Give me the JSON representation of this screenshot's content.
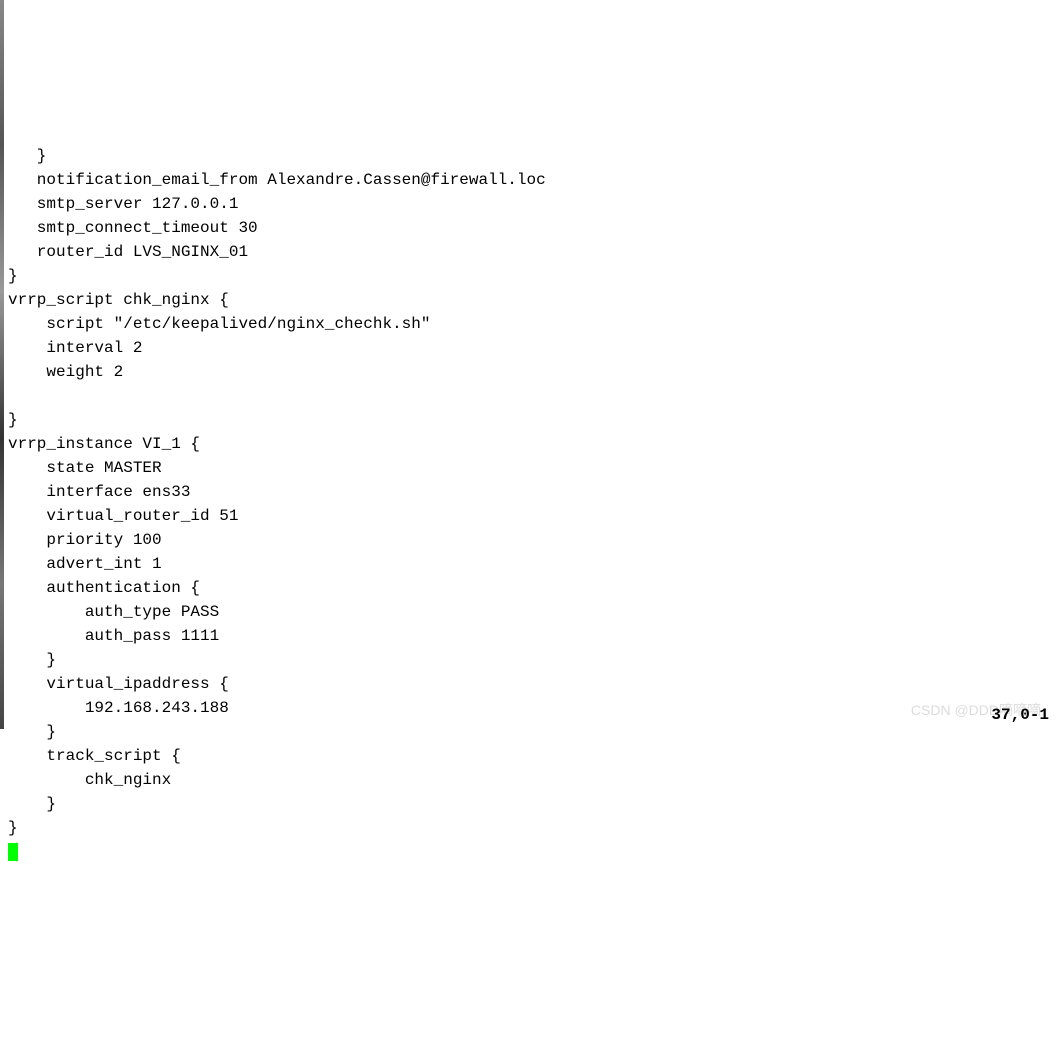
{
  "config_lines": [
    "   }",
    "   notification_email_from Alexandre.Cassen@firewall.loc",
    "   smtp_server 127.0.0.1",
    "   smtp_connect_timeout 30",
    "   router_id LVS_NGINX_01",
    "}",
    "vrrp_script chk_nginx {",
    "    script \"/etc/keepalived/nginx_chechk.sh\"",
    "    interval 2",
    "    weight 2",
    "",
    "}",
    "vrrp_instance VI_1 {",
    "    state MASTER",
    "    interface ens33",
    "    virtual_router_id 51",
    "    priority 100",
    "    advert_int 1",
    "    authentication {",
    "        auth_type PASS",
    "        auth_pass 1111",
    "    }",
    "    virtual_ipaddress {",
    "        192.168.243.188",
    "    }",
    "    track_script {",
    "        chk_nginx",
    "    }",
    "}"
  ],
  "status_position": "37,0-1",
  "watermark_text": "CSDN @DDD嘀嘀嘀"
}
